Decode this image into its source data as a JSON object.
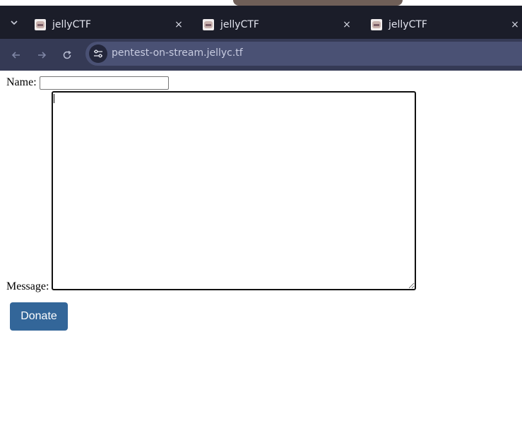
{
  "browser": {
    "tabs": [
      {
        "title": "jellyCTF",
        "close": "×"
      },
      {
        "title": "jellyCTF",
        "close": "×"
      },
      {
        "title": "jellyCTF",
        "close": "×"
      }
    ],
    "url": "pentest-on-stream.jellyc.tf",
    "icons": {
      "tab_list": "chevron-down-icon",
      "back": "arrow-left-icon",
      "forward": "arrow-right-icon",
      "reload": "reload-icon",
      "site_info": "tune-icon",
      "favicon": "jellyctf-favicon"
    },
    "colors": {
      "tabbar": "#1b1d29",
      "toolbar": "#353a55",
      "omnibox": "#4a5174"
    }
  },
  "form": {
    "name_label": "Name:",
    "name_value": "",
    "message_label": "Message:",
    "message_value": "",
    "submit_label": "Donate"
  },
  "colors": {
    "button": "#336699"
  }
}
